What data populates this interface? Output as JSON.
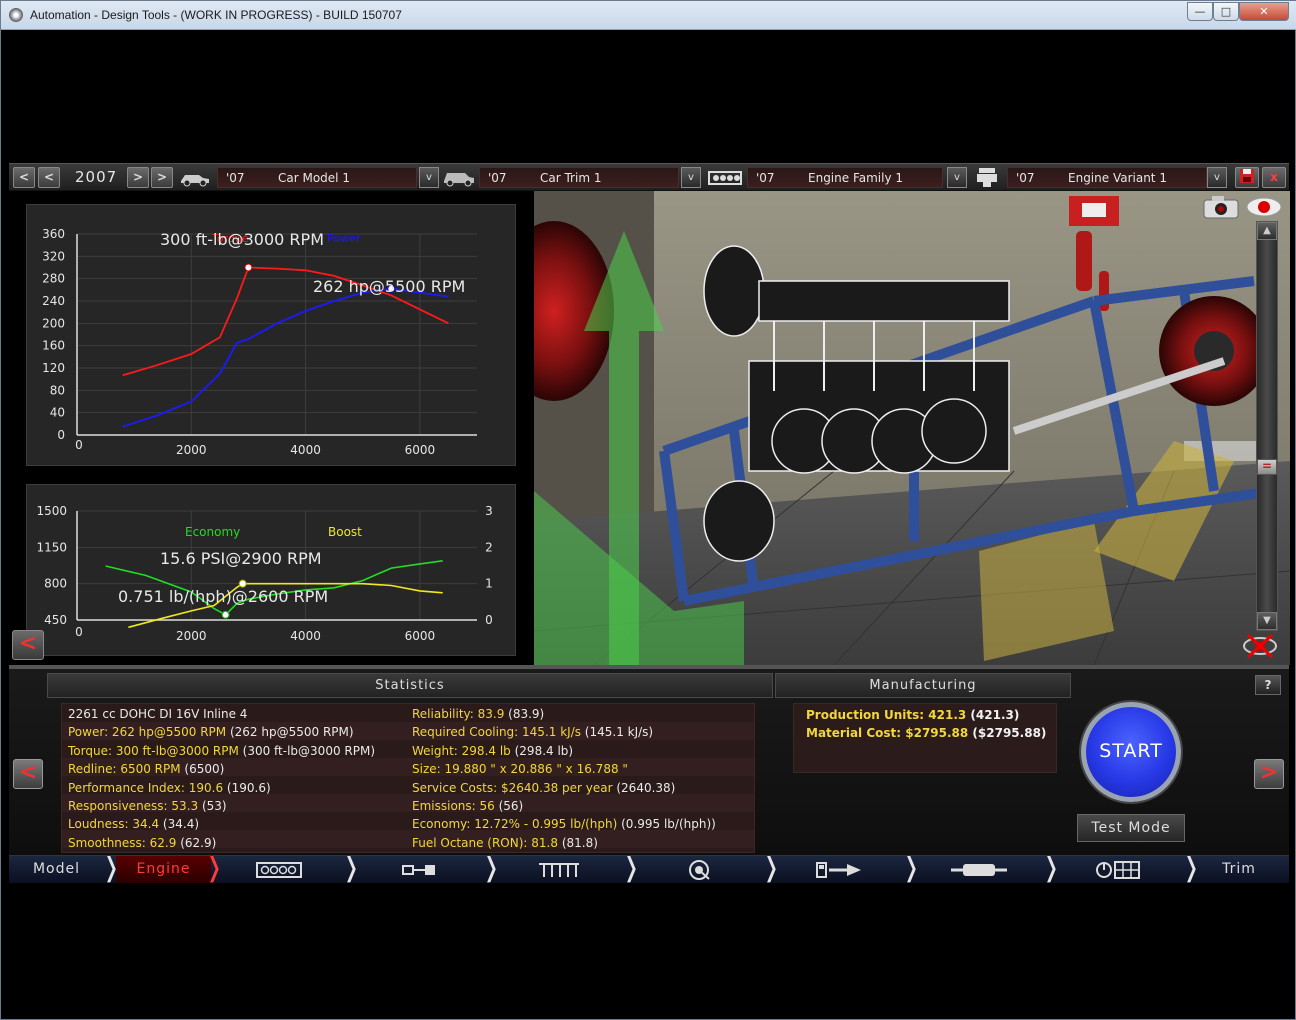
{
  "window": {
    "title": "Automation - Design Tools - (WORK IN PROGRESS) - BUILD 150707",
    "minimize": "—",
    "maximize": "□",
    "close": "✕"
  },
  "toolbar": {
    "year": "2007",
    "prev_fast": "<",
    "prev": "<",
    "next": ">",
    "next_fast": ">",
    "car_model": {
      "year": "'07",
      "name": "Car Model 1"
    },
    "car_trim": {
      "year": "'07",
      "name": "Car Trim 1"
    },
    "engine_family": {
      "year": "'07",
      "name": "Engine Family 1"
    },
    "engine_variant": {
      "year": "'07",
      "name": "Engine Variant 1"
    },
    "dropdown": "v",
    "save_icon": "save-icon",
    "close_label": "x"
  },
  "torque_chart": {
    "annotation_torque": "300 ft-lb@3000 RPM",
    "annotation_power": "262 hp@5500 RPM",
    "legend_torque": "Torque",
    "legend_power": "Power",
    "colors": {
      "torque": "#ff1a1a",
      "power": "#1a1aff"
    }
  },
  "economy_chart": {
    "annotation_boost": "15.6 PSI@2900 RPM",
    "annotation_economy": "0.751 lb/(hph)@2600 RPM",
    "legend_economy": "Economy",
    "legend_boost": "Boost",
    "colors": {
      "economy": "#22dd22",
      "boost": "#f0e81a"
    }
  },
  "chart_data": [
    {
      "type": "line",
      "xlim": [
        0,
        7000
      ],
      "ylim": [
        0,
        360
      ],
      "x_ticks": [
        "0",
        "2000",
        "4000",
        "6000"
      ],
      "y_ticks": [
        "0",
        "40",
        "80",
        "120",
        "160",
        "200",
        "240",
        "280",
        "320",
        "360"
      ],
      "series": [
        {
          "name": "Torque",
          "x": [
            800,
            1400,
            2000,
            2500,
            2800,
            3000,
            3500,
            4000,
            4500,
            5000,
            5500,
            6000,
            6500
          ],
          "values": [
            107,
            125,
            145,
            175,
            245,
            300,
            298,
            295,
            285,
            268,
            250,
            225,
            200
          ]
        },
        {
          "name": "Power",
          "x": [
            800,
            1400,
            2000,
            2500,
            2800,
            3000,
            3500,
            4000,
            4500,
            5000,
            5500,
            6000,
            6500
          ],
          "values": [
            15,
            35,
            60,
            110,
            165,
            172,
            200,
            222,
            240,
            255,
            262,
            255,
            248
          ]
        }
      ]
    },
    {
      "type": "line",
      "xlim": [
        0,
        7000
      ],
      "ylim": [
        450,
        1500
      ],
      "y2lim": [
        0,
        3
      ],
      "x_ticks": [
        "0",
        "2000",
        "4000",
        "6000"
      ],
      "y_ticks": [
        "450",
        "800",
        "1150",
        "1500"
      ],
      "y2_ticks": [
        "0",
        "1",
        "2",
        "3"
      ],
      "series": [
        {
          "name": "Economy",
          "x": [
            500,
            1200,
            2000,
            2400,
            2600,
            2800,
            3000,
            3500,
            4000,
            4500,
            5000,
            5500,
            6000,
            6400
          ],
          "values": [
            970,
            880,
            720,
            560,
            500,
            610,
            650,
            700,
            740,
            760,
            830,
            950,
            990,
            1020
          ]
        },
        {
          "name": "Boost",
          "x": [
            900,
            1500,
            2000,
            2400,
            2800,
            2900,
            3500,
            4000,
            4500,
            5000,
            5500,
            6000,
            6400
          ],
          "values": [
            -0.2,
            0.05,
            0.25,
            0.4,
            0.9,
            1.0,
            1.0,
            1.0,
            1.0,
            1.0,
            0.95,
            0.8,
            0.75
          ]
        }
      ]
    }
  ],
  "statistics": {
    "header": "Statistics",
    "left": [
      {
        "k": "2261 cc DOHC DI 16V Inline 4",
        "v": "",
        "plain": true
      },
      {
        "k": "Power: 262 hp@5500 RPM",
        "v": " (262 hp@5500 RPM)"
      },
      {
        "k": "Torque: 300 ft-lb@3000 RPM",
        "v": " (300 ft-lb@3000 RPM)"
      },
      {
        "k": "Redline: 6500 RPM",
        "v": " (6500)"
      },
      {
        "k": "Performance Index: 190.6",
        "v": " (190.6)"
      },
      {
        "k": "Responsiveness: 53.3",
        "v": " (53)"
      },
      {
        "k": "Loudness: 34.4",
        "v": " (34.4)"
      },
      {
        "k": "Smoothness: 62.9",
        "v": " (62.9)"
      }
    ],
    "right": [
      {
        "k": "Reliability: 83.9",
        "v": " (83.9)"
      },
      {
        "k": "Required Cooling: 145.1 kJ/s",
        "v": " (145.1 kJ/s)"
      },
      {
        "k": "Weight: 298.4 lb",
        "v": " (298.4 lb)"
      },
      {
        "k": "Size: 19.880 \" x 20.886 \" x 16.788 \"",
        "v": ""
      },
      {
        "k": "Service Costs: $2640.38 per year",
        "v": " (2640.38)"
      },
      {
        "k": "Emissions: 56",
        "v": " (56)"
      },
      {
        "k": "Economy: 12.72% - 0.995 lb/(hph)",
        "v": " (0.995 lb/(hph))"
      },
      {
        "k": "Fuel Octane (RON): 81.8",
        "v": " (81.8)"
      }
    ]
  },
  "manufacturing": {
    "header": "Manufacturing",
    "production_units": {
      "k": "Production Units: 421.3",
      "v": " (421.3)"
    },
    "material_cost": {
      "k": "Material Cost: $2795.88",
      "v": " ($2795.88)"
    },
    "help": "?"
  },
  "controls": {
    "start": "START",
    "test_mode": "Test Mode",
    "left_arrow": "<",
    "right_arrow": ">"
  },
  "nav": {
    "model": "Model",
    "engine": "Engine",
    "trim": "Trim",
    "chevron": "❭",
    "icons": [
      "engine-block-icon",
      "crankshaft-icon",
      "valvetrain-icon",
      "turbo-icon",
      "fuel-icon",
      "exhaust-icon",
      "tuning-icon"
    ]
  }
}
